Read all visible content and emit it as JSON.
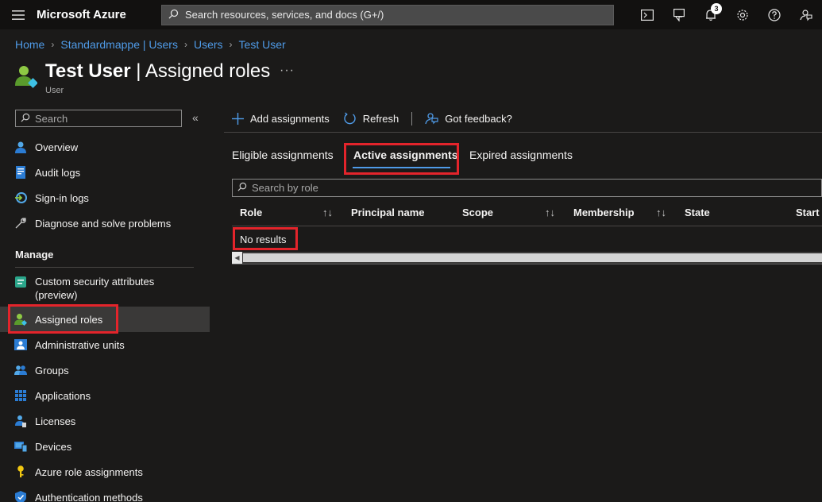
{
  "topbar": {
    "brand": "Microsoft Azure",
    "search_placeholder": "Search resources, services, and docs (G+/)",
    "notification_count": "3",
    "icons": [
      "cloud-shell-icon",
      "directory-filter-icon",
      "bell-icon",
      "gear-icon",
      "help-icon",
      "feedback-icon"
    ]
  },
  "breadcrumb": [
    "Home",
    "Standardmappe | Users",
    "Users",
    "Test User"
  ],
  "page": {
    "title_bold": "Test User",
    "title_rest": " | Assigned roles",
    "more": "···",
    "subtitle": "User"
  },
  "sidebar": {
    "search_placeholder": "Search",
    "collapse": "«",
    "items": [
      {
        "label": "Overview",
        "icon": "user-icon"
      },
      {
        "label": "Audit logs",
        "icon": "audit-log-icon"
      },
      {
        "label": "Sign-in logs",
        "icon": "sign-in-icon"
      },
      {
        "label": "Diagnose and solve problems",
        "icon": "wrench-icon"
      }
    ],
    "manage_heading": "Manage",
    "manage_items": [
      {
        "label": "Custom security attributes (preview)",
        "line1": "Custom security attributes",
        "line2": "(preview)",
        "icon": "attributes-icon"
      },
      {
        "label": "Assigned roles",
        "icon": "user-role-icon",
        "selected": true
      },
      {
        "label": "Administrative units",
        "icon": "admin-units-icon"
      },
      {
        "label": "Groups",
        "icon": "groups-icon"
      },
      {
        "label": "Applications",
        "icon": "applications-icon"
      },
      {
        "label": "Licenses",
        "icon": "licenses-icon"
      },
      {
        "label": "Devices",
        "icon": "devices-icon"
      },
      {
        "label": "Azure role assignments",
        "icon": "key-icon"
      },
      {
        "label": "Authentication methods",
        "icon": "shield-icon"
      }
    ]
  },
  "commands": {
    "add": "Add assignments",
    "refresh": "Refresh",
    "feedback": "Got feedback?"
  },
  "tabs": [
    "Eligible assignments",
    "Active assignments",
    "Expired assignments"
  ],
  "active_tab": "Active assignments",
  "table": {
    "search_placeholder": "Search by role",
    "columns": [
      "Role",
      "Principal name",
      "Scope",
      "Membership",
      "State",
      "Start t"
    ],
    "sort_glyph": "↑↓",
    "empty_text": "No results"
  },
  "colors": {
    "accent": "#4f9be8",
    "highlight_box": "#e3242b",
    "background": "#1b1a19",
    "topbar": "#121110"
  }
}
